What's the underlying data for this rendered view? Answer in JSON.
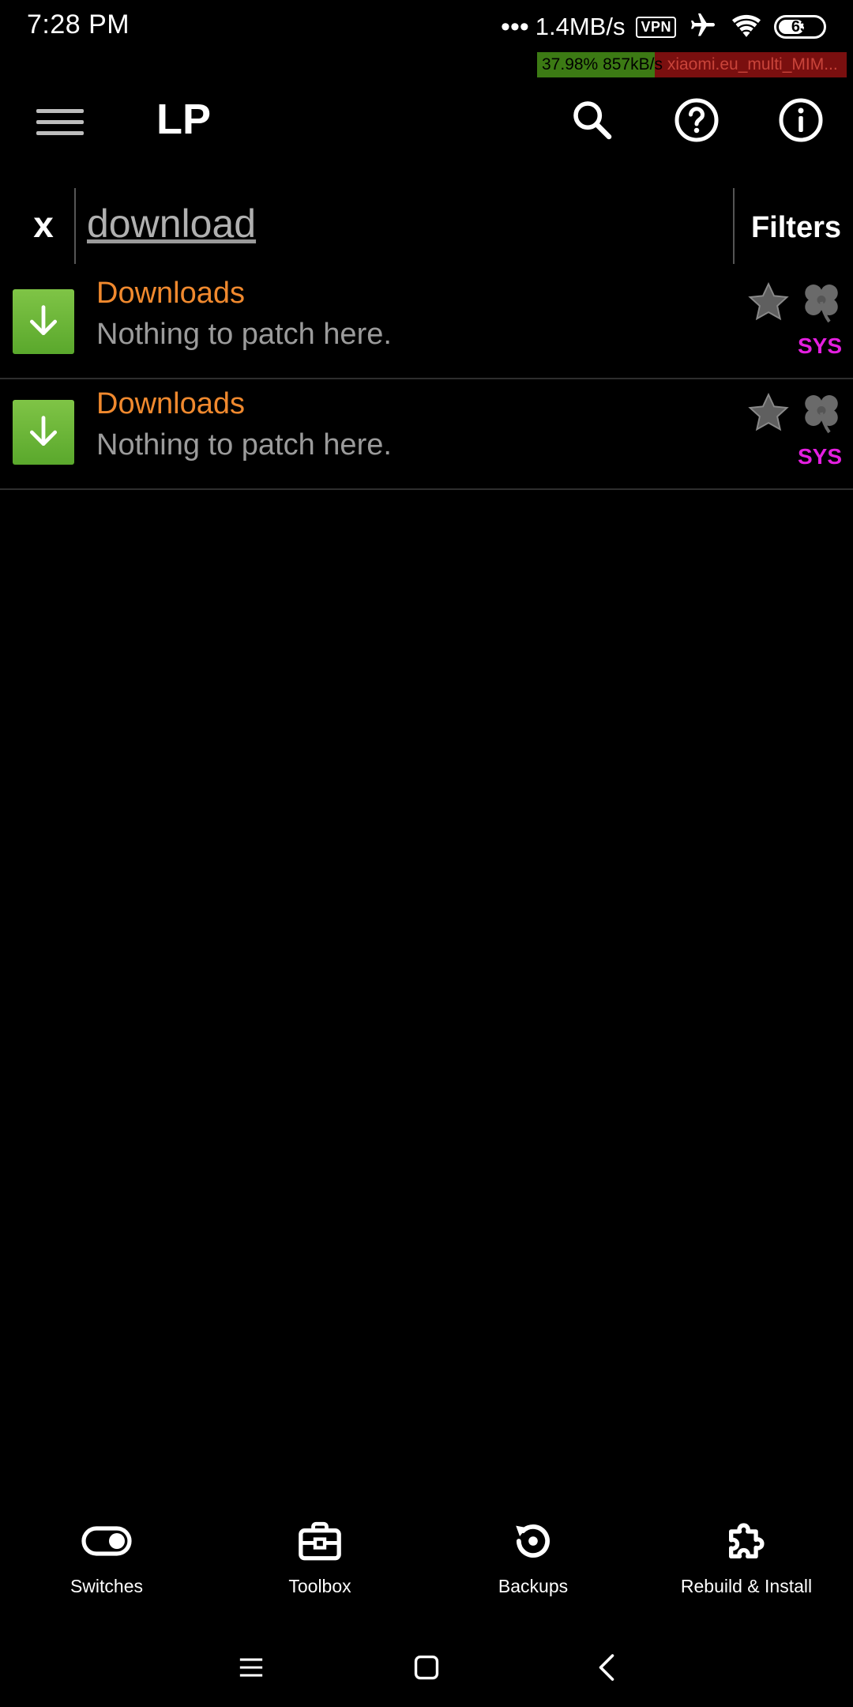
{
  "status_bar": {
    "time": "7:28 PM",
    "dots": "•••",
    "net_speed": "1.4MB/s",
    "vpn": "VPN",
    "battery": "63",
    "battery_level": 0.63
  },
  "download_strip": {
    "percent": "37.98%",
    "speed": "857kB/s",
    "file": "xiaomi.eu_multi_MIM...",
    "progress": 0.3798
  },
  "app_bar": {
    "menu_icon": "hamburger-menu-icon",
    "title": "LP",
    "actions": [
      "search-icon",
      "help-icon",
      "info-icon"
    ]
  },
  "search": {
    "clear_label": "x",
    "value": "download",
    "placeholder": "",
    "filters_label": "Filters"
  },
  "app_list": {
    "items": [
      {
        "title": "Downloads",
        "status": "Nothing to patch here.",
        "badge": "SYS",
        "icon": "download-arrow-icon"
      },
      {
        "title": "Downloads",
        "status": "Nothing to patch here.",
        "badge": "SYS",
        "icon": "download-arrow-icon"
      }
    ]
  },
  "bottom_nav": {
    "items": [
      {
        "label": "Switches",
        "icon": "toggle-switch-icon"
      },
      {
        "label": "Toolbox",
        "icon": "toolbox-icon"
      },
      {
        "label": "Backups",
        "icon": "backup-restore-icon"
      },
      {
        "label": "Rebuild & Install",
        "icon": "puzzle-piece-icon"
      }
    ]
  },
  "system_nav": {
    "icons": [
      "recents-menu-icon",
      "home-square-icon",
      "back-chevron-icon"
    ]
  },
  "colors": {
    "background": "#000000",
    "item_title": "#f0892e",
    "item_status": "#9b9b9b",
    "sys_badge": "#e41fe0",
    "app_icon_green": "#6ab83a",
    "download_progress": "#3c7a14",
    "download_remaining": "#7a0f0f"
  }
}
